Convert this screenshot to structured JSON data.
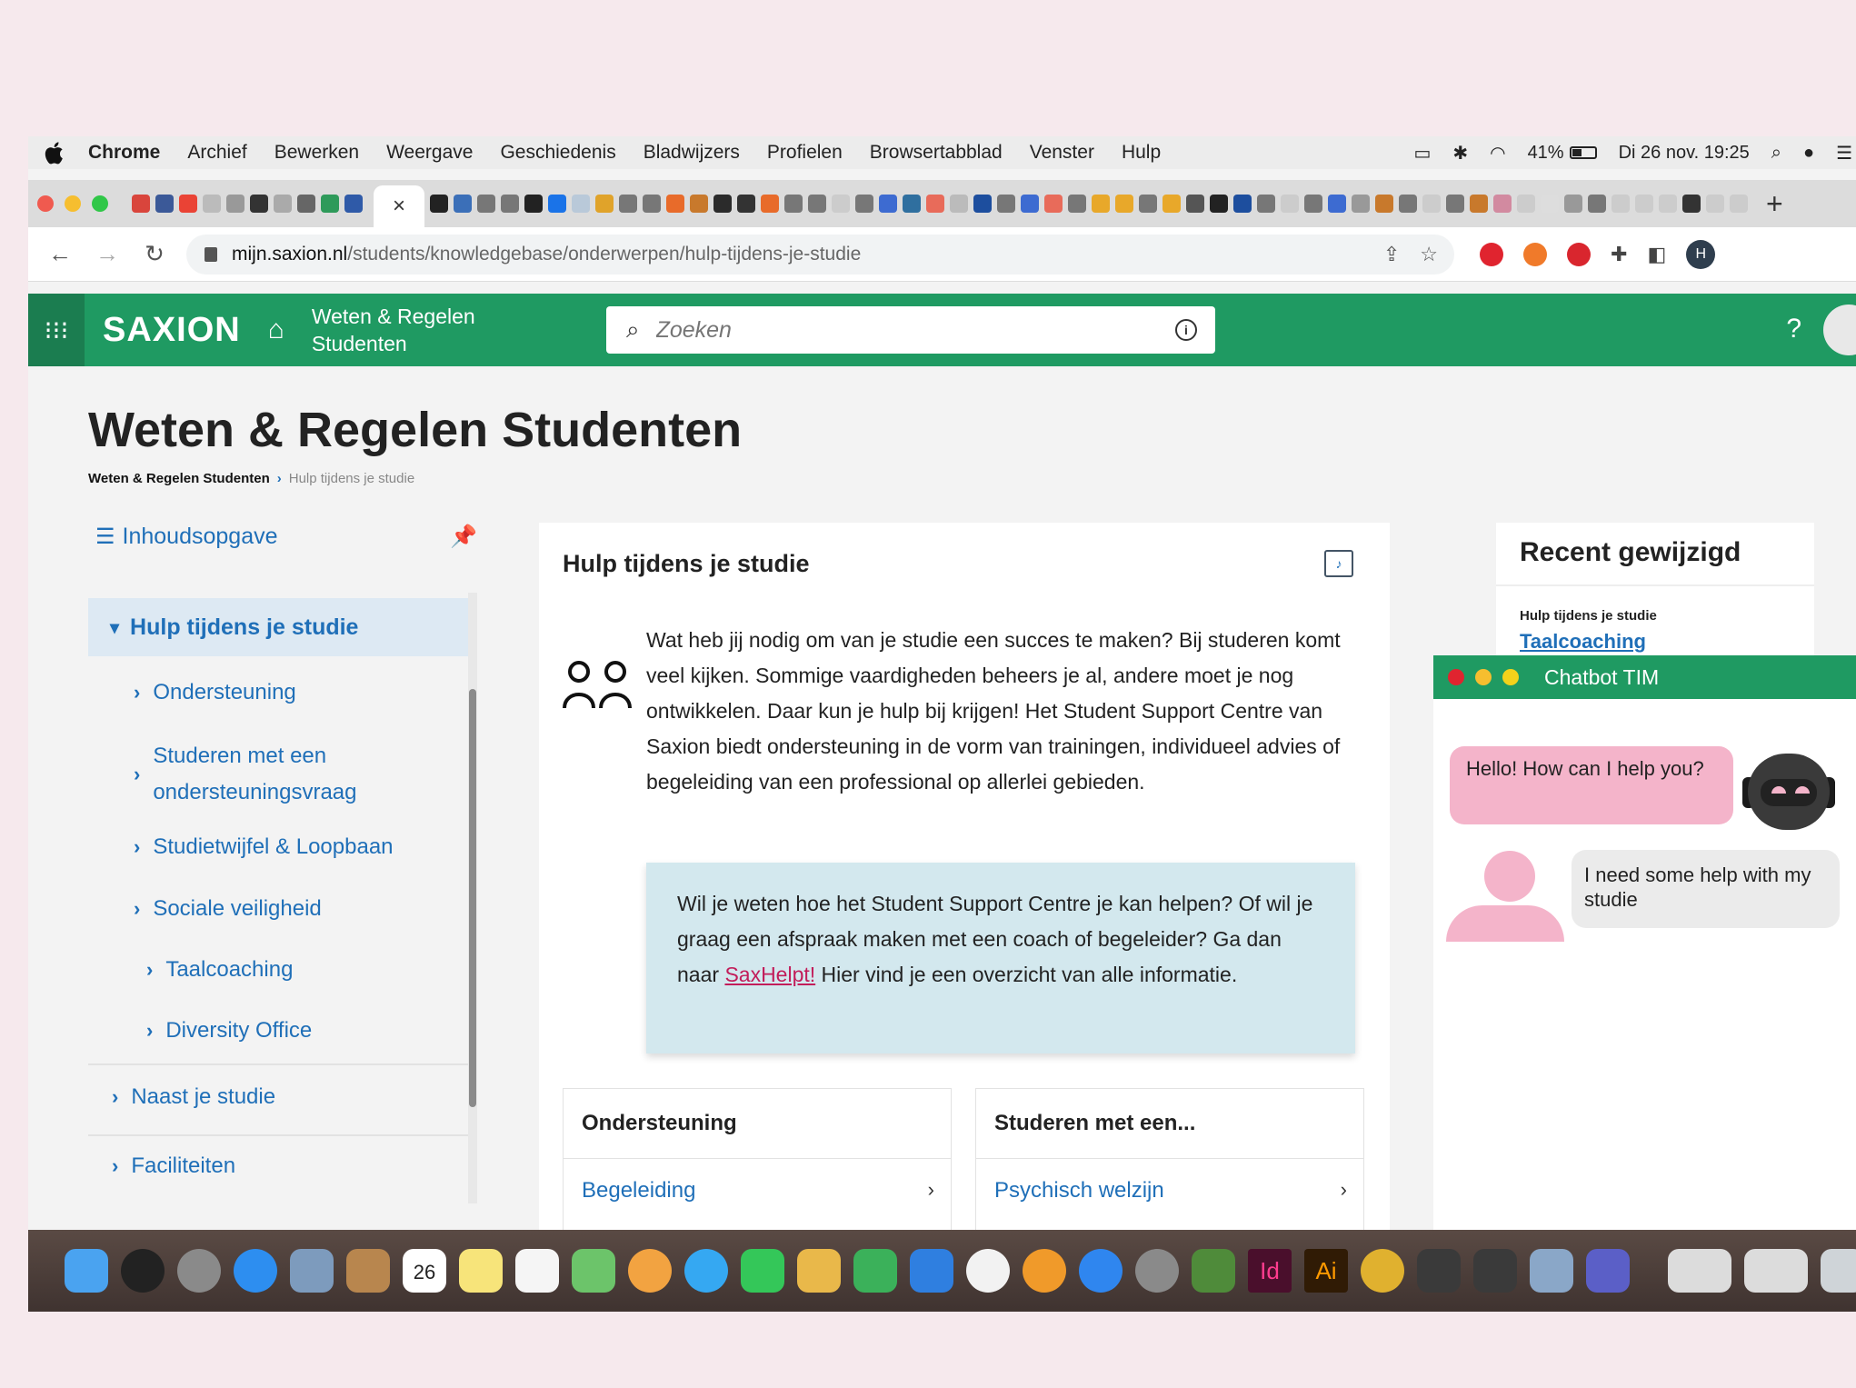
{
  "menubar": {
    "apple": "",
    "items": [
      "Chrome",
      "Archief",
      "Bewerken",
      "Weergave",
      "Geschiedenis",
      "Bladwijzers",
      "Profielen",
      "Browsertabblad",
      "Venster",
      "Hulp"
    ],
    "battery": "41%",
    "datetime": "Di 26 nov. 19:25"
  },
  "tabs": {
    "active_close": "×",
    "new_tab": "+"
  },
  "address": {
    "host": "mijn.saxion.nl",
    "path": "/students/knowledgebase/onderwerpen/hulp-tijdens-je-studie",
    "profile_initial": "H"
  },
  "header": {
    "logo": "SAXION",
    "site_title": "Weten & Regelen Studenten",
    "search_placeholder": "Zoeken",
    "help": "?"
  },
  "page": {
    "title": "Weten & Regelen Studenten",
    "breadcrumb": [
      "Weten & Regelen Studenten",
      "Hulp tijdens je studie"
    ]
  },
  "sidebar": {
    "toc_label": "Inhoudsopgave",
    "active": "Hulp tijdens je studie",
    "children": [
      "Ondersteuning",
      "Studeren met een ondersteuningsvraag",
      "Studietwijfel & Loopbaan",
      "Sociale veiligheid",
      "Taalcoaching",
      "Diversity Office"
    ],
    "top_items": [
      "Naast je studie",
      "Faciliteiten"
    ]
  },
  "main": {
    "title": "Hulp tijdens je studie",
    "intro": "Wat heb jij nodig om van je studie een succes te maken? Bij studeren komt veel kijken. Sommige vaardigheden beheers je al, andere moet je nog ontwikkelen. Daar kun je hulp bij krijgen! Het Student Support Centre van Saxion biedt ondersteuning in de vorm van trainingen, individueel advies of begeleiding van een professional op allerlei gebieden.",
    "callout_before": "Wil je weten hoe het Student Support Centre je kan helpen? Of wil je graag een afspraak maken met een coach of begeleider? Ga dan naar ",
    "callout_link": "SaxHelpt!",
    "callout_after": " Hier vind je een overzicht van alle informatie.",
    "cards": [
      {
        "title": "Ondersteuning",
        "link": "Begeleiding"
      },
      {
        "title": "Studeren met een...",
        "link": "Psychisch welzijn"
      }
    ]
  },
  "recent": {
    "title": "Recent gewijzigd",
    "small": "Hulp tijdens je studie",
    "link": "Taalcoaching"
  },
  "chatbot": {
    "title": "Chatbot TIM",
    "bot_message": "Hello! How can I help you?",
    "user_message": "I need some help with my studie"
  },
  "dock": {
    "calendar_day": "26",
    "id_label": "Id",
    "ai_label": "Ai"
  },
  "colors": {
    "saxion_green": "#1f9a62",
    "link_blue": "#1f6fb8",
    "chat_pink": "#f4b4ca"
  }
}
